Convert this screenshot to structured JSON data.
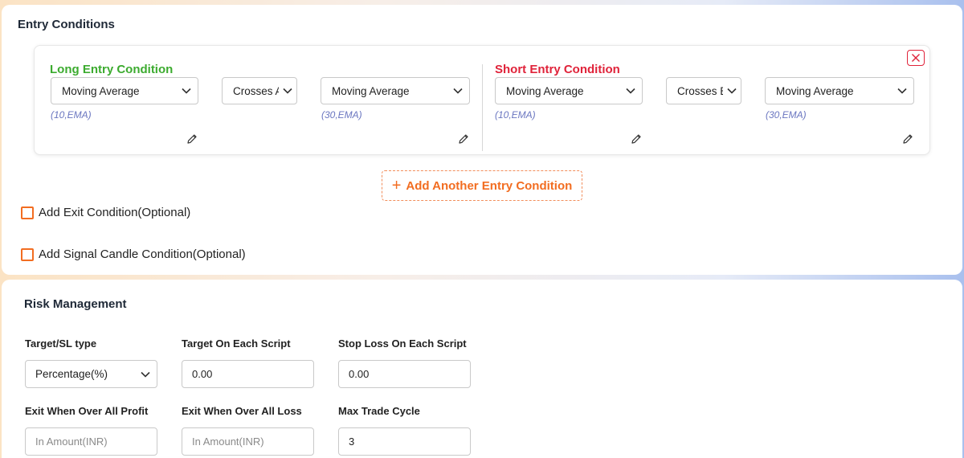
{
  "entry_conditions": {
    "title": "Entry Conditions",
    "long": {
      "title": "Long Entry Condition",
      "indicator1": "Moving Average",
      "indicator1_params": "(10,EMA)",
      "comparator": "Crosses Above",
      "indicator2": "Moving Average",
      "indicator2_params": "(30,EMA)"
    },
    "short": {
      "title": "Short Entry Condition",
      "indicator1": "Moving Average",
      "indicator1_params": "(10,EMA)",
      "comparator": "Crosses Below",
      "indicator2": "Moving Average",
      "indicator2_params": "(30,EMA)"
    },
    "add_button": "Add Another Entry Condition",
    "exit_checkbox": "Add Exit Condition(Optional)",
    "signal_checkbox": "Add Signal Candle Condition(Optional)"
  },
  "risk_management": {
    "title": "Risk Management",
    "target_sl_type_label": "Target/SL type",
    "target_sl_type_value": "Percentage(%)",
    "target_label": "Target On Each Script",
    "target_value": "0.00",
    "stoploss_label": "Stop Loss On Each Script",
    "stoploss_value": "0.00",
    "overall_profit_label": "Exit When Over All Profit",
    "overall_profit_placeholder": "In Amount(INR)",
    "overall_loss_label": "Exit When Over All Loss",
    "overall_loss_placeholder": "In Amount(INR)",
    "max_cycle_label": "Max Trade Cycle",
    "max_cycle_value": "3"
  },
  "colors": {
    "long": "#3cab2f",
    "short": "#e0233a",
    "accent": "#f26d21",
    "param": "#6a76c0"
  },
  "icons": [
    "chevron-down-icon",
    "pencil-icon",
    "close-icon",
    "plus-icon"
  ]
}
